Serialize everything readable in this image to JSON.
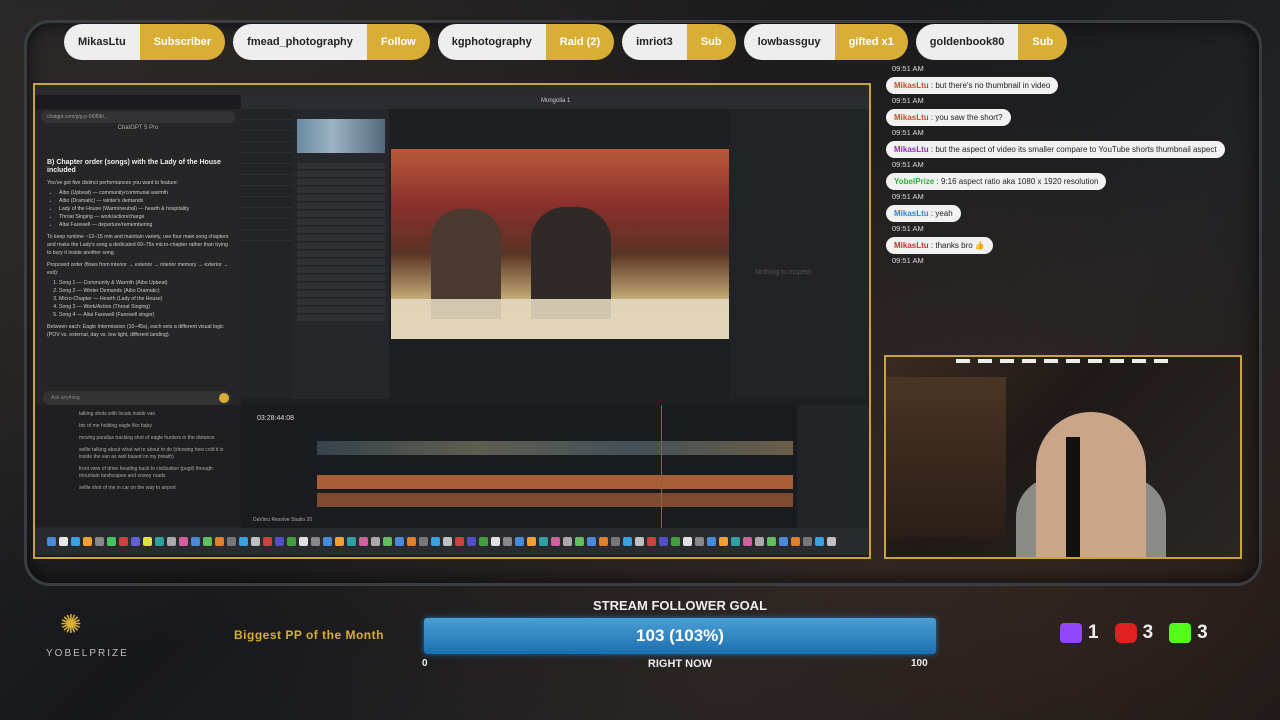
{
  "alerts": [
    {
      "name": "MikasLtu",
      "event": "Subscriber"
    },
    {
      "name": "fmead_photography",
      "event": "Follow"
    },
    {
      "name": "kgphotography",
      "event": "Raid (2)"
    },
    {
      "name": "imriot3",
      "event": "Sub"
    },
    {
      "name": "lowbassguy",
      "event": "gifted x1"
    },
    {
      "name": "goldenbook80",
      "event": "Sub"
    }
  ],
  "browser": {
    "url": "chatgpt.com/g/g-p-6f0f0b/...",
    "gpt_title": "ChatGPT 5 Pro",
    "heading": "B) Chapter order (songs) with the Lady of the House included",
    "intro": "You've got five distinct performances you want to feature:",
    "features": [
      "Aibo (Upbeat) — community/communal warmth",
      "Aibo (Dramatic) — winter's demands",
      "Lady of the House (Warm/neutral) — hearth & hospitality",
      "Throat Singing — work/action/charge",
      "Altai Farewell — departure/remembering"
    ],
    "para": "To keep runtime ~12–15 min and maintain variety, use four main song chapters and make the Lady's song a dedicated 60–75s micro-chapter rather than trying to bury it inside another song.",
    "proposed": "Proposed order (flows from interior → exterior → interior memory → exterior → exit):",
    "songs": [
      "Song 1 — Community & Warmth (Aibo Upbeat)",
      "Song 2 — Winter Demands (Aibo Dramatic)",
      "Micro-Chapter — Hearth (Lady of the House)",
      "Song 3 — Work/Action (Throat Singing)",
      "Song 4 — Altai Farewell (Farewell singer)"
    ],
    "between": "Between each: Eagle Intermission (10–45s), each sets a different visual logic (POV vs. external, day vs. low light, different landing).",
    "ask_placeholder": "Ask anything",
    "notes": [
      "talking shots with locals inside van",
      "bts of me holding eagle like baby",
      "moving parallax tracking shot of eagle hunters in the distance",
      "selfie talking about what we're about to do (showing how cold it is inside the van as well based on my breath)",
      "front view of drive heading back to civilization (pugil) through mountain landscapes and snowy roads",
      "selfie shot of me in car on the way to airport"
    ]
  },
  "resolve": {
    "project": "Mongolia 1",
    "inspector_empty": "Nothing to inspect",
    "timecode": "03:28:44:08",
    "app_label": "DaVinci Resolve Studio 20"
  },
  "chat": [
    {
      "time": "09:51 AM",
      "user": "MikasLtu",
      "color": "#c94a2a",
      "text": "but there's no thumbnail in video"
    },
    {
      "time": "09:51 AM",
      "user": "MikasLtu",
      "color": "#c94a2a",
      "text": "you saw the short?"
    },
    {
      "time": "09:51 AM",
      "user": "MikasLtu",
      "color": "#8a2fb0",
      "text": "but the aspect of video its smaller compare to YouTube shorts thumbnail aspect"
    },
    {
      "time": "09:51 AM",
      "user": "YobelPrize",
      "color": "#2fb03c",
      "text": "9:16 aspect ratio aka 1080 x 1920 resolution"
    },
    {
      "time": "09:51 AM",
      "user": "MikasLtu",
      "color": "#2a86c9",
      "text": "yeah"
    },
    {
      "time": "09:51 AM",
      "user": "MikasLtu",
      "color": "#c9302a",
      "text": "thanks bro 👍"
    }
  ],
  "chat_first_time": "09:51 AM",
  "logo": {
    "word": "YOBELPRIZE"
  },
  "biggest": "Biggest PP of the Month",
  "goal": {
    "title": "STREAM FOLLOWER GOAL",
    "value": "103 (103%)",
    "min": "0",
    "max": "100",
    "sub": "RIGHT NOW",
    "progress": 1.03
  },
  "counters": [
    {
      "platform": "twitch",
      "count": "1",
      "color": "#9146ff"
    },
    {
      "platform": "youtube",
      "count": "3",
      "color": "#e02020"
    },
    {
      "platform": "kick",
      "count": "3",
      "color": "#53fc18"
    }
  ]
}
